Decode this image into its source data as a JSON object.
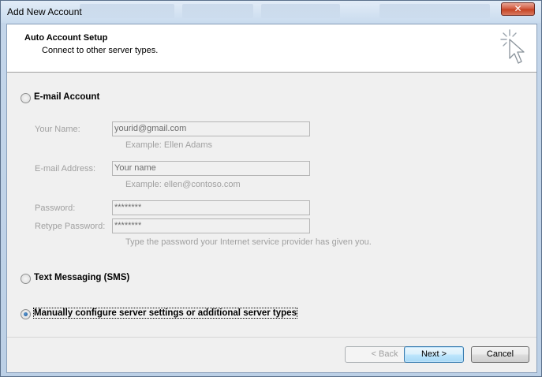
{
  "window": {
    "title": "Add New Account",
    "close_glyph": "✕"
  },
  "header": {
    "title": "Auto Account Setup",
    "subtitle": "Connect to other server types.",
    "icon": "cursor-sparkle-icon"
  },
  "options": {
    "email_account": {
      "label": "E-mail Account",
      "selected": false
    },
    "text_messaging": {
      "label": "Text Messaging (SMS)",
      "selected": false
    },
    "manual": {
      "label": "Manually configure server settings or additional server types",
      "selected": true
    }
  },
  "form": {
    "name": {
      "label": "Your Name:",
      "value": "yourid@gmail.com",
      "example": "Example: Ellen Adams"
    },
    "email": {
      "label": "E-mail Address:",
      "value": "Your name",
      "example": "Example: ellen@contoso.com"
    },
    "password": {
      "label": "Password:",
      "value": "********"
    },
    "retype": {
      "label": "Retype Password:",
      "value": "********"
    },
    "password_hint": "Type the password your Internet service provider has given you."
  },
  "buttons": {
    "back": "< Back",
    "next": "Next >",
    "cancel": "Cancel"
  }
}
